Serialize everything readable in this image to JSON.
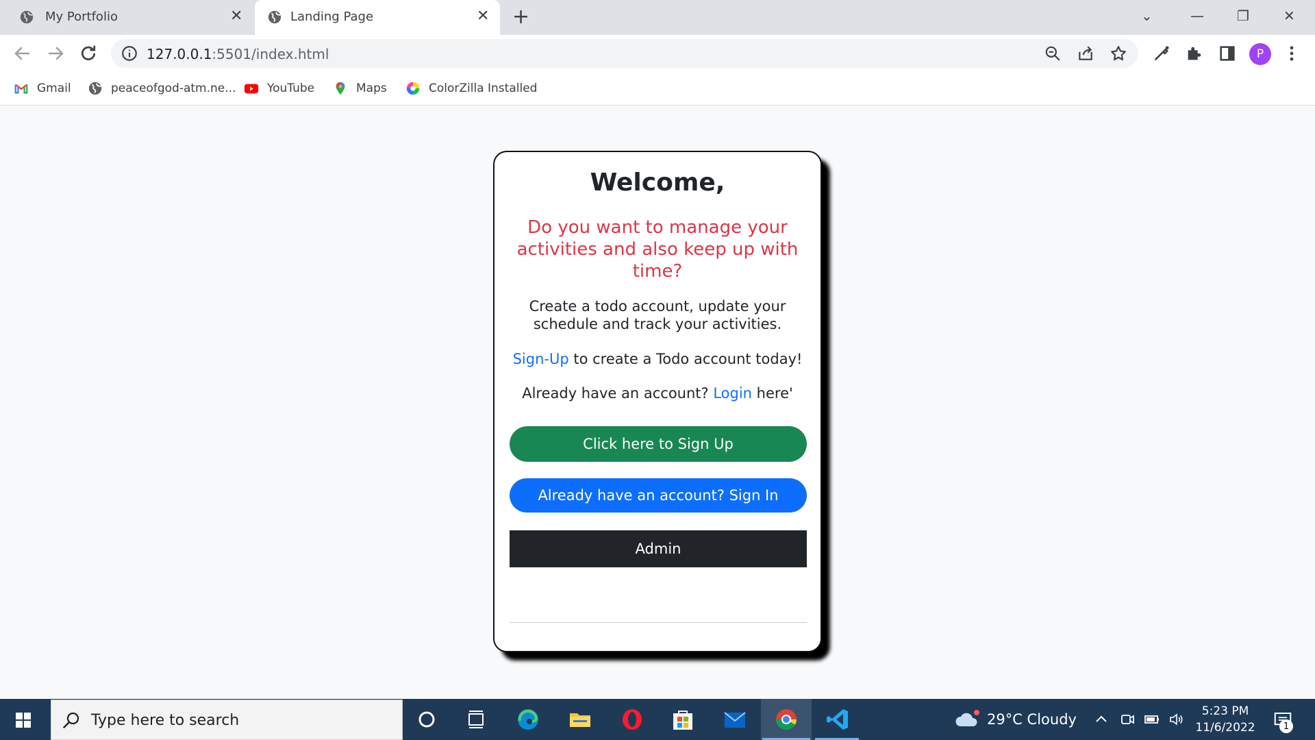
{
  "browser": {
    "tabs": [
      {
        "title": "My Portfolio",
        "active": false
      },
      {
        "title": "Landing Page",
        "active": true
      }
    ],
    "url_host": "127.0.0.1",
    "url_rest": ":5501/index.html",
    "profile_initial": "P",
    "bookmarks": [
      {
        "label": "Gmail",
        "icon": "gmail-icon"
      },
      {
        "label": "peaceofgod-atm.ne...",
        "icon": "globe-icon"
      },
      {
        "label": "YouTube",
        "icon": "youtube-icon"
      },
      {
        "label": "Maps",
        "icon": "maps-icon"
      },
      {
        "label": "ColorZilla Installed",
        "icon": "colorzilla-icon"
      }
    ]
  },
  "page": {
    "title": "Welcome,",
    "question": "Do you want to manage your activities and also keep up with time?",
    "description": "Create a todo account, update your schedule and track your activities.",
    "signup_link": "Sign-Up",
    "signup_text": " to create a Todo account today!",
    "login_prefix": "Already have an account? ",
    "login_link": "Login",
    "login_suffix": " here'",
    "buttons": {
      "signup": "Click here to Sign Up",
      "signin": "Already have an account? Sign In",
      "admin": "Admin"
    },
    "colors": {
      "question": "#dc3545",
      "link": "#0d6efd",
      "signup_button": "#198754",
      "signin_button": "#0d6efd",
      "admin_button": "#212529"
    }
  },
  "taskbar": {
    "search_placeholder": "Type here to search",
    "weather": "29°C  Cloudy",
    "time": "5:23 PM",
    "date": "11/6/2022",
    "notification_count": "1"
  }
}
